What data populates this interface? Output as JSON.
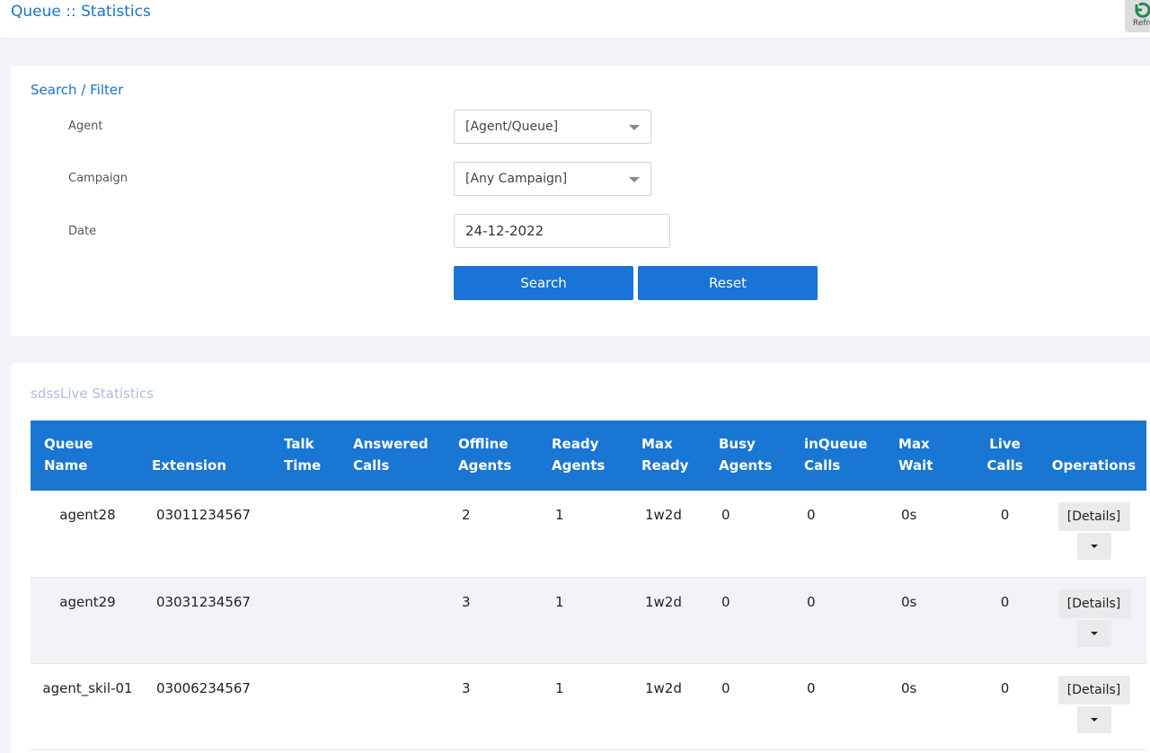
{
  "header": {
    "title": "Queue :: Statistics",
    "refresh_label": "Refresh"
  },
  "filter": {
    "title": "Search / Filter",
    "agent_label": "Agent",
    "agent_value": "[Agent/Queue]",
    "campaign_label": "Campaign",
    "campaign_value": "[Any Campaign]",
    "date_label": "Date",
    "date_value": "24-12-2022",
    "search_label": "Search",
    "reset_label": "Reset"
  },
  "stats": {
    "title": "sdssLive Statistics",
    "columns": [
      "Queue Name",
      "Extension",
      "Talk Time",
      "Answered Calls",
      "Offline Agents",
      "Ready Agents",
      "Max Ready",
      "Busy Agents",
      "inQueue Calls",
      "Max Wait",
      "Live Calls",
      "Operations"
    ],
    "rows": [
      {
        "queue_name": "agent28",
        "extension": "03011234567",
        "talk_time": "",
        "answered_calls": "",
        "offline_agents": "2",
        "ready_agents": "1",
        "max_ready": "1w2d",
        "busy_agents": "0",
        "inqueue_calls": "0",
        "max_wait": "0s",
        "live_calls": "0",
        "details_label": "[Details]"
      },
      {
        "queue_name": "agent29",
        "extension": "03031234567",
        "talk_time": "",
        "answered_calls": "",
        "offline_agents": "3",
        "ready_agents": "1",
        "max_ready": "1w2d",
        "busy_agents": "0",
        "inqueue_calls": "0",
        "max_wait": "0s",
        "live_calls": "0",
        "details_label": "[Details]"
      },
      {
        "queue_name": "agent_skil-01",
        "extension": "03006234567",
        "talk_time": "",
        "answered_calls": "",
        "offline_agents": "3",
        "ready_agents": "1",
        "max_ready": "1w2d",
        "busy_agents": "0",
        "inqueue_calls": "0",
        "max_wait": "0s",
        "live_calls": "0",
        "details_label": "[Details]"
      }
    ]
  },
  "colors": {
    "accent": "#1a73d6",
    "table_header": "#1976d2",
    "refresh_icon": "#1e8a4c"
  },
  "icons": {
    "refresh": "refresh-icon",
    "dropdown": "chevron-down-icon"
  }
}
